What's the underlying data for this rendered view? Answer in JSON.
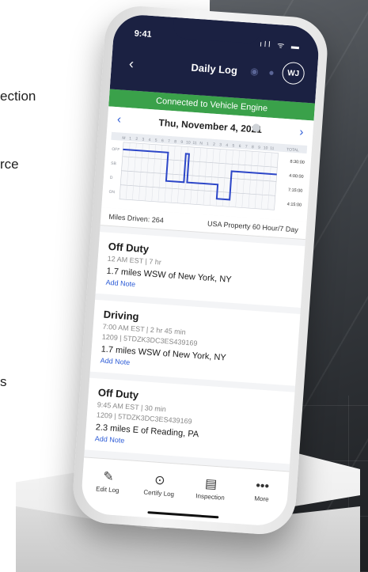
{
  "side_text": [
    "ection",
    "rce",
    "s"
  ],
  "status_bar": {
    "time": "9:41",
    "icons": "ıll ᯤ ▬"
  },
  "nav": {
    "back": "‹",
    "title": "Daily Log",
    "avatar": "WJ"
  },
  "connection": "Connected to Vehicle Engine",
  "date_bar": {
    "prev": "‹",
    "date": "Thu, November 4, 2021",
    "next": "›"
  },
  "graph": {
    "hour_labels": [
      "M",
      "1",
      "2",
      "3",
      "4",
      "5",
      "6",
      "7",
      "8",
      "9",
      "10",
      "11",
      "N",
      "1",
      "2",
      "3",
      "4",
      "5",
      "6",
      "7",
      "8",
      "9",
      "10",
      "11",
      "TOTAL"
    ],
    "row_labels": [
      "OFF",
      "SB",
      "D",
      "ON"
    ],
    "totals": [
      "8:30:00",
      "4:00:00",
      "7:15:00",
      "4:15:00"
    ],
    "color": "#2c46c8"
  },
  "summary": {
    "miles": "Miles Driven: 264",
    "rule": "USA Property 60 Hour/7 Day"
  },
  "entries": [
    {
      "status": "Off Duty",
      "meta": "12 AM EST | 7 hr",
      "meta2": "",
      "location": "1.7 miles WSW of New York, NY",
      "note": "Add Note"
    },
    {
      "status": "Driving",
      "meta": "7:00 AM EST | 2 hr 45 min",
      "meta2": "1209 | 5TDZK3DC3ES439169",
      "location": "1.7 miles WSW of New York, NY",
      "note": "Add Note"
    },
    {
      "status": "Off Duty",
      "meta": "9:45 AM EST | 30 min",
      "meta2": "1209 | 5TDZK3DC3ES439169",
      "location": "2.3 miles E of Reading, PA",
      "note": "Add Note"
    }
  ],
  "tabs": [
    {
      "icon": "✎",
      "label": "Edit Log"
    },
    {
      "icon": "⊙",
      "label": "Certify Log"
    },
    {
      "icon": "▤",
      "label": "Inspection"
    },
    {
      "icon": "•••",
      "label": "More"
    }
  ]
}
